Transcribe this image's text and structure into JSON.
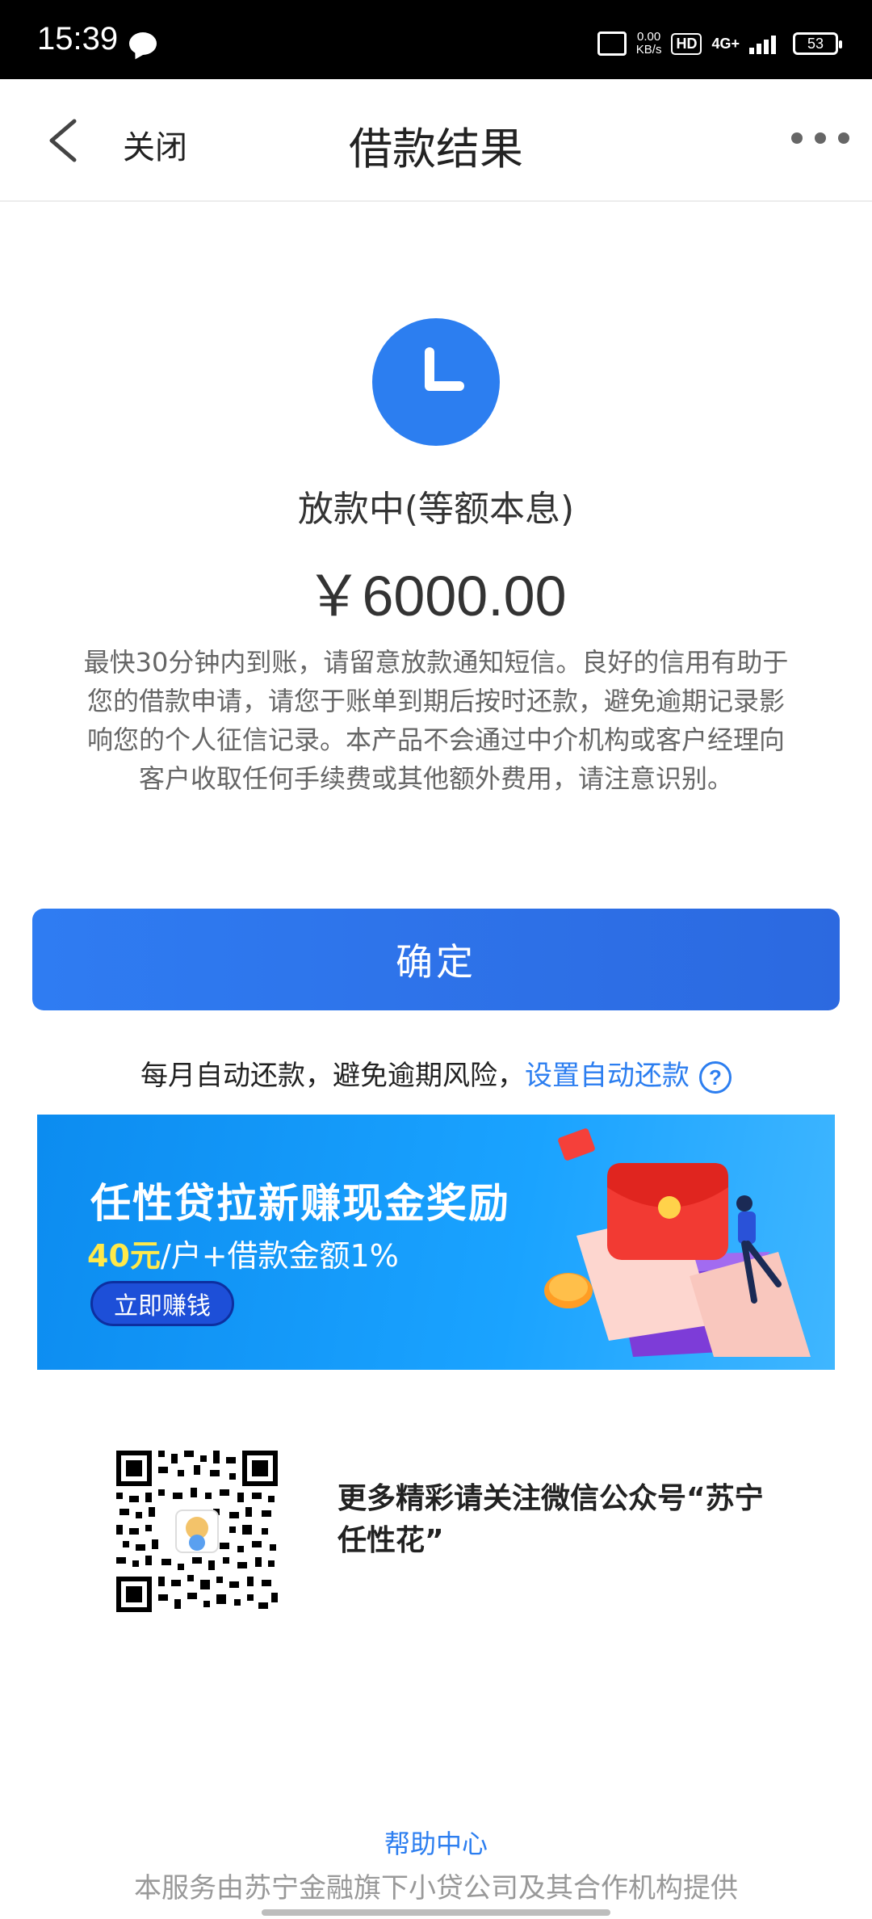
{
  "status_bar": {
    "time": "15:39",
    "net_speed_value": "0.00",
    "net_speed_unit": "KB/s",
    "hd_label": "HD",
    "network_label": "4G+",
    "battery": "53"
  },
  "nav": {
    "close_label": "关闭",
    "title": "借款结果"
  },
  "result": {
    "status": "放款中(等额本息)",
    "amount": "￥6000.00",
    "note": "最快30分钟内到账，请留意放款通知短信。良好的信用有助于您的借款申请，请您于账单到期后按时还款，避免逾期记录影响您的个人征信记录。本产品不会通过中介机构或客户经理向客户收取任何手续费或其他额外费用，请注意识别。"
  },
  "confirm_label": "确定",
  "auto_repay": {
    "text": "每月自动还款，避免逾期风险，",
    "link": "设置自动还款",
    "help_glyph": "?"
  },
  "banner": {
    "headline": "任性贷拉新赚现金奖励",
    "reward_highlight": "40元",
    "reward_rest": "/户+借款金额1%",
    "cta": "立即赚钱"
  },
  "qr_section": {
    "text": "更多精彩请关注微信公众号“苏宁任性花”"
  },
  "footer": {
    "help_center": "帮助中心",
    "provider": "本服务由苏宁金融旗下小贷公司及其合作机构提供"
  },
  "colors": {
    "accent": "#2c7ef0",
    "banner_bg": "#1aa3ff",
    "highlight_yellow": "#ffe94a"
  },
  "icons": {
    "back": "chevron-left-icon",
    "more": "more-dots-icon",
    "status": "clock-icon",
    "help": "question-circle-icon",
    "qr": "qr-code-icon"
  }
}
